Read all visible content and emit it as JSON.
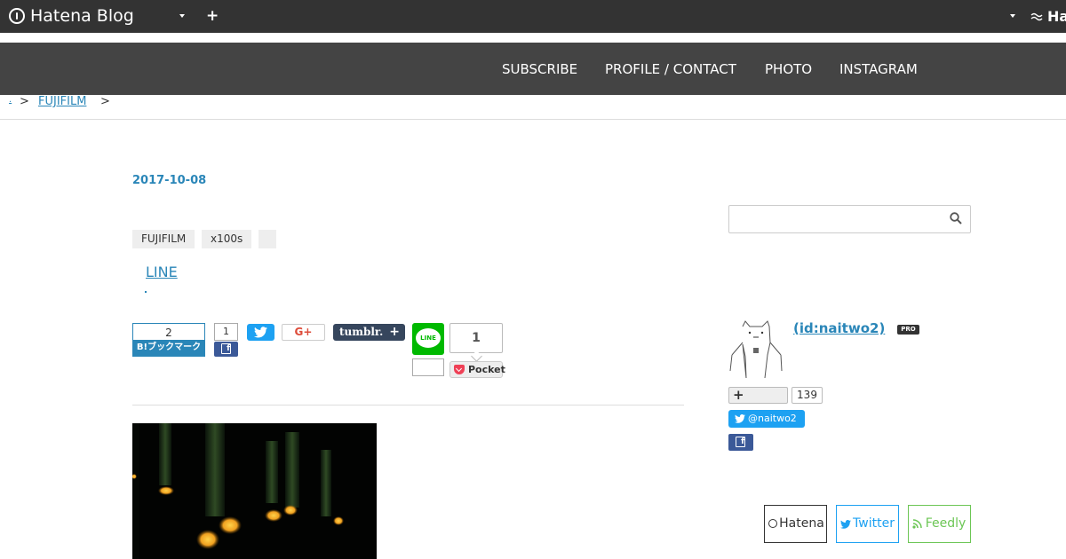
{
  "topbar": {
    "logo_text": "Hatena Blog",
    "right_logo_text": "Ha"
  },
  "nav": {
    "items": [
      "SUBSCRIBE",
      "PROFILE / CONTACT",
      "PHOTO",
      "INSTAGRAM"
    ]
  },
  "breadcrumb": {
    "home": ".",
    "separator": ">",
    "category": "FUJIFILM"
  },
  "entry": {
    "date": "2017-10-08",
    "tags": [
      "FUJIFILM",
      "x100s",
      ""
    ],
    "line_link": "LINE"
  },
  "share": {
    "hatena_count": "2",
    "hatena_label": "B!ブックマーク",
    "facebook_count": "1",
    "googleplus_label": "G+",
    "tumblr_label": "tumblr.",
    "tumblr_plus": "+",
    "line_label": "LINE",
    "pocket_count": "1",
    "pocket_label": "Pocket"
  },
  "sidebar": {
    "search_placeholder": "",
    "author": " (id:naitwo2)",
    "pro_badge": "PRO",
    "follow_plus": "+",
    "follow_count": "139",
    "twitter_handle": "@naitwo2",
    "subscribe": {
      "hatena": "Hatena",
      "twitter": "Twitter",
      "feedly": "Feedly"
    }
  },
  "colors": {
    "link": "#2a86b8",
    "topbar": "#333333",
    "blognav": "#444444",
    "twitter": "#1da1f2",
    "facebook": "#3b5998",
    "line": "#00b900",
    "feedly": "#6cc655"
  }
}
